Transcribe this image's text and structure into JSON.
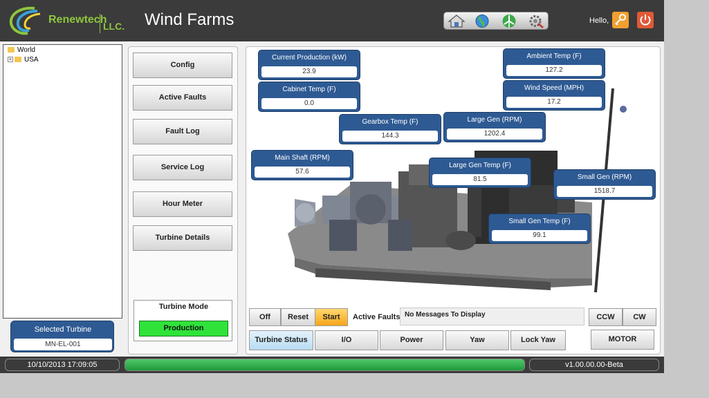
{
  "header": {
    "logo_text": "Renewtech",
    "logo_suffix": "LLC.",
    "title": "Wind Farms",
    "greeting": "Hello,",
    "nav_icons": [
      "home-icon",
      "globe-icon",
      "turbine-icon",
      "settings-icon"
    ],
    "user_icon": "key-icon",
    "logout_icon": "power-icon"
  },
  "tree": [
    {
      "label": "World"
    },
    {
      "label": "USA"
    }
  ],
  "selected_turbine": {
    "title": "Selected Turbine",
    "value": "MN-EL-001"
  },
  "menu": [
    "Config",
    "Active Faults",
    "Fault Log",
    "Service Log",
    "Hour Meter",
    "Turbine Details"
  ],
  "turbine_mode": {
    "title": "Turbine Mode",
    "value": "Production",
    "color": "#2fe33a"
  },
  "gauges": {
    "current_production": {
      "label": "Current Production (kW)",
      "value": "23.9"
    },
    "cabinet_temp": {
      "label": "Cabinet Temp (F)",
      "value": "0.0"
    },
    "ambient_temp": {
      "label": "Ambient Temp (F)",
      "value": "127.2"
    },
    "wind_speed": {
      "label": "Wind Speed (MPH)",
      "value": "17.2"
    },
    "gearbox_temp": {
      "label": "Gearbox Temp (F)",
      "value": "144.3"
    },
    "large_gen_rpm": {
      "label": "Large Gen (RPM)",
      "value": "1202.4"
    },
    "main_shaft": {
      "label": "Main Shaft (RPM)",
      "value": "57.6"
    },
    "large_gen_temp": {
      "label": "Large Gen Temp (F)",
      "value": "81.5"
    },
    "small_gen_rpm": {
      "label": "Small Gen (RPM)",
      "value": "1518.7"
    },
    "small_gen_temp": {
      "label": "Small Gen Temp (F)",
      "value": "99.1"
    }
  },
  "controls": {
    "off": "Off",
    "reset": "Reset",
    "start": "Start",
    "active_faults": "Active Faults",
    "messages": "No Messages To Display",
    "ccw": "CCW",
    "cw": "CW",
    "motor": "MOTOR"
  },
  "tabs": [
    "Turbine Status",
    "I/O",
    "Power",
    "Yaw",
    "Lock Yaw"
  ],
  "status": {
    "datetime": "10/10/2013 17:09:05",
    "progress": 1.0,
    "version": "v1.00.00.00-Beta"
  },
  "colors": {
    "accent": "#2e5a93",
    "brand": "#8dc63f",
    "header": "#3b3b3b"
  }
}
